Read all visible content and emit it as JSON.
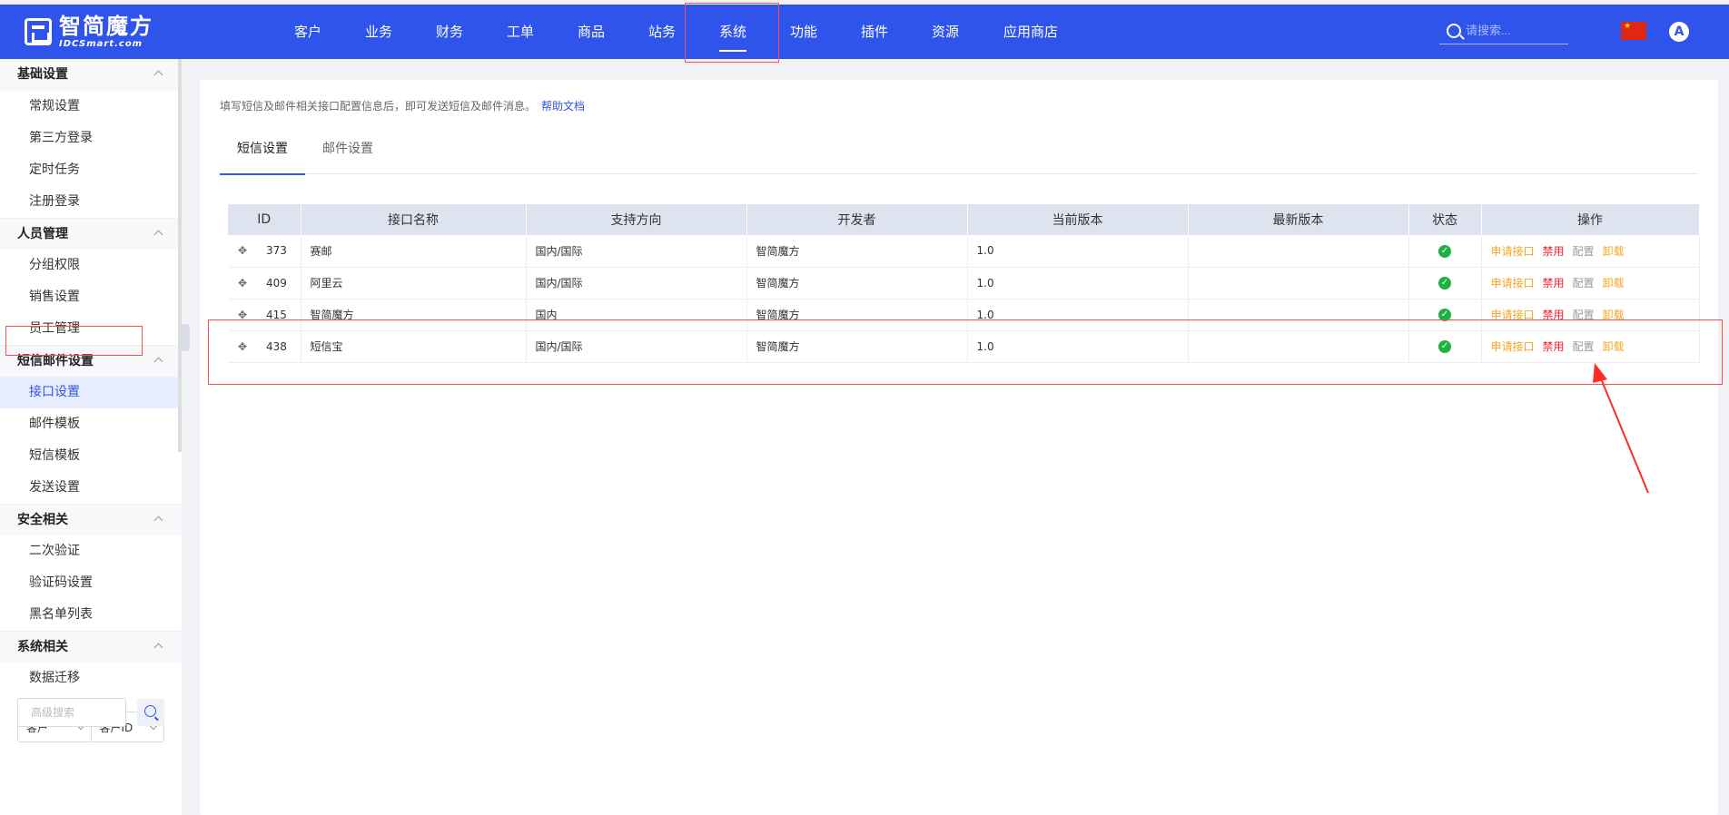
{
  "header": {
    "logo_cn": "智简魔方",
    "logo_en": "IDCSmart.com",
    "nav": [
      "客户",
      "业务",
      "财务",
      "工单",
      "商品",
      "站务",
      "系统",
      "功能",
      "插件",
      "资源",
      "应用商店"
    ],
    "active_nav": "系统",
    "search_placeholder": "请搜索...",
    "avatar_letter": "A",
    "flag_color": "#de2910",
    "accent_color": "#2f54eb"
  },
  "sidebar": {
    "groups": [
      {
        "title": "基础设置",
        "items": [
          "常规设置",
          "第三方登录",
          "定时任务",
          "注册登录"
        ]
      },
      {
        "title": "人员管理",
        "items": [
          "分组权限",
          "销售设置",
          "员工管理"
        ]
      },
      {
        "title": "短信邮件设置",
        "items": [
          "接口设置",
          "邮件模板",
          "短信模板",
          "发送设置"
        ]
      },
      {
        "title": "安全相关",
        "items": [
          "二次验证",
          "验证码设置",
          "黑名单列表"
        ]
      },
      {
        "title": "系统相关",
        "items": [
          "数据迁移"
        ]
      }
    ],
    "active_item": "接口设置",
    "filter": {
      "select1": "客户",
      "select2": "客户ID",
      "search_placeholder": "高级搜索"
    }
  },
  "main": {
    "tip": "填写短信及邮件相关接口配置信息后，即可发送短信及邮件消息。",
    "help_link": "帮助文档",
    "tabs": [
      "短信设置",
      "邮件设置"
    ],
    "active_tab": "短信设置",
    "table": {
      "columns": [
        "ID",
        "接口名称",
        "支持方向",
        "开发者",
        "当前版本",
        "最新版本",
        "状态",
        "操作"
      ],
      "rows": [
        {
          "id": "373",
          "name": "赛邮",
          "direction": "国内/国际",
          "developer": "智简魔方",
          "version": "1.0",
          "latest": ""
        },
        {
          "id": "409",
          "name": "阿里云",
          "direction": "国内/国际",
          "developer": "智简魔方",
          "version": "1.0",
          "latest": ""
        },
        {
          "id": "415",
          "name": "智简魔方",
          "direction": "国内",
          "developer": "智简魔方",
          "version": "1.0",
          "latest": ""
        },
        {
          "id": "438",
          "name": "短信宝",
          "direction": "国内/国际",
          "developer": "智简魔方",
          "version": "1.0",
          "latest": ""
        }
      ],
      "actions": [
        "申请接口",
        "禁用",
        "配置",
        "卸载"
      ],
      "status_icon": "check-circle-icon"
    }
  }
}
